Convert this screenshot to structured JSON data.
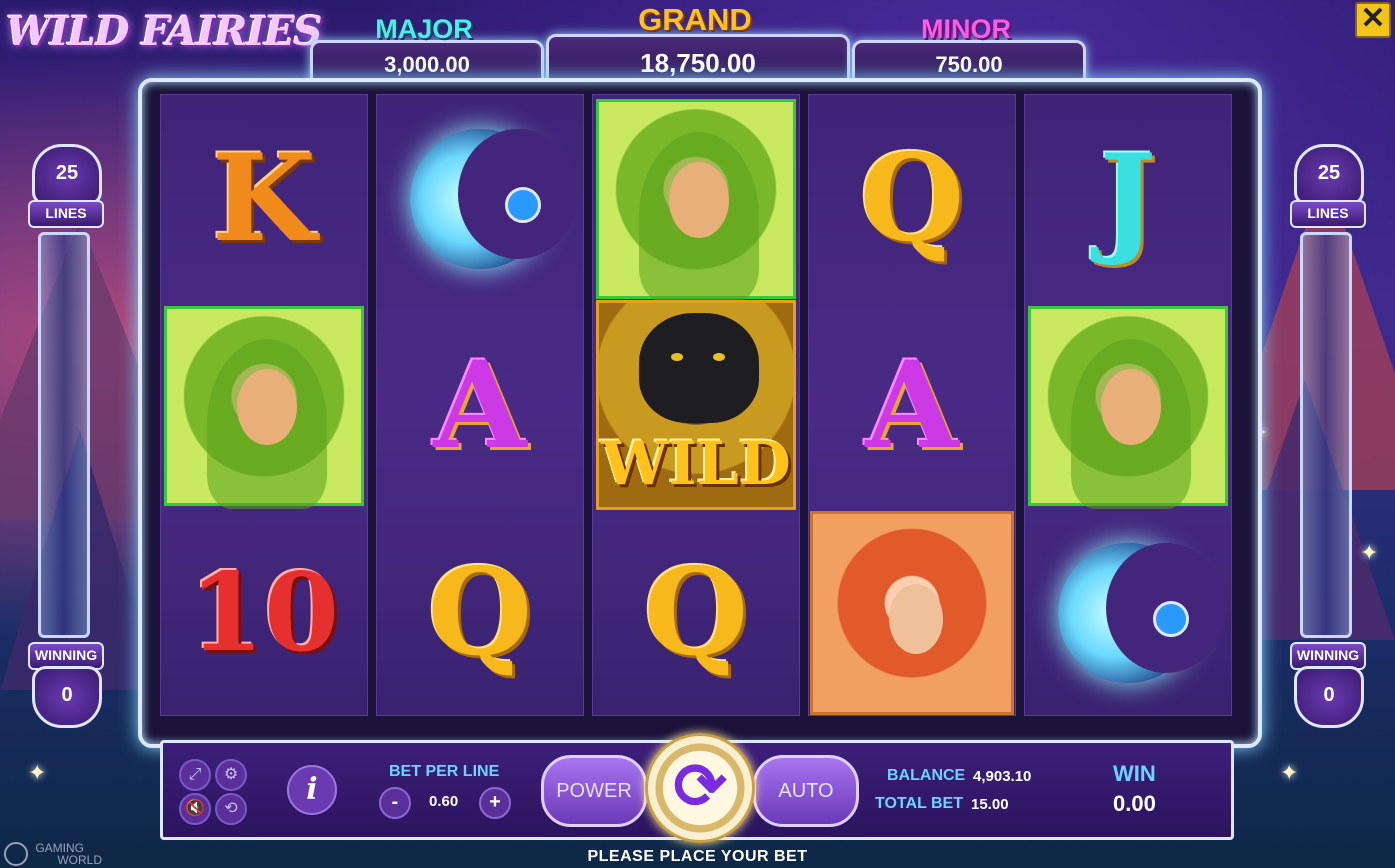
{
  "game": {
    "logo": "WILD FAIRIES",
    "close_symbol": "✕"
  },
  "jackpots": {
    "major": {
      "label": "MAJOR",
      "value": "3,000.00"
    },
    "grand": {
      "label": "GRAND",
      "value": "18,750.00"
    },
    "minor": {
      "label": "MINOR",
      "value": "750.00"
    }
  },
  "meters": {
    "left": {
      "lines": "25",
      "lines_label": "LINES",
      "winning_label": "WINNING",
      "winning": "0"
    },
    "right": {
      "lines": "25",
      "lines_label": "LINES",
      "winning_label": "WINNING",
      "winning": "0"
    }
  },
  "reels": [
    [
      "K",
      "fairy-green",
      "10"
    ],
    [
      "moon",
      "A",
      "Q"
    ],
    [
      "fairy-green",
      "WILD",
      "Q"
    ],
    [
      "Q",
      "A",
      "fairy-red"
    ],
    [
      "J",
      "fairy-green",
      "moon"
    ]
  ],
  "symbols": {
    "wild_text": "WILD"
  },
  "controls": {
    "icons": [
      "fullscreen-icon",
      "settings-icon",
      "mute-icon",
      "history-icon"
    ],
    "info_label": "i",
    "bet_per_line_label": "BET PER LINE",
    "bet_per_line": "0.60",
    "minus": "-",
    "plus": "+",
    "power_label": "POWER",
    "auto_label": "AUTO",
    "balance_label": "BALANCE",
    "balance": "4,903.10",
    "total_bet_label": "TOTAL BET",
    "total_bet": "15.00",
    "win_label": "WIN",
    "win": "0.00"
  },
  "message": "PLEASE PLACE YOUR BET",
  "brand": {
    "line1": "GAMING",
    "line2": "WORLD"
  },
  "colors": {
    "accent_gold": "#ffc21a",
    "accent_cyan": "#6ad6ff",
    "bg_purple": "#3d1f7a"
  }
}
